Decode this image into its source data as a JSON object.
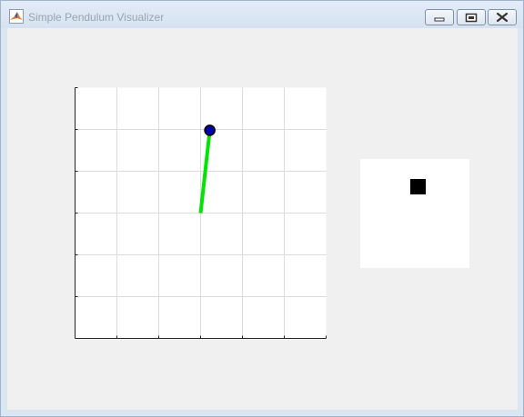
{
  "window": {
    "title": "Simple Pendulum Visualizer",
    "icon": "matlab-icon"
  },
  "titlebar_buttons": {
    "minimize_icon": "minimize-icon",
    "restore_icon": "restore-icon",
    "close_icon": "close-icon"
  },
  "pendulum_plot": {
    "grid": true,
    "grid_columns": 6,
    "grid_rows": 6,
    "tick_labels_shown": false,
    "pivot": {
      "x": 0,
      "y": 0
    },
    "bob": {
      "x": 0.22,
      "y": 1.98
    },
    "rod_color": "#00e600",
    "bob_color": "#0000b3"
  },
  "square_display": {
    "background": "#ffffff",
    "marker_color": "#000000"
  }
}
